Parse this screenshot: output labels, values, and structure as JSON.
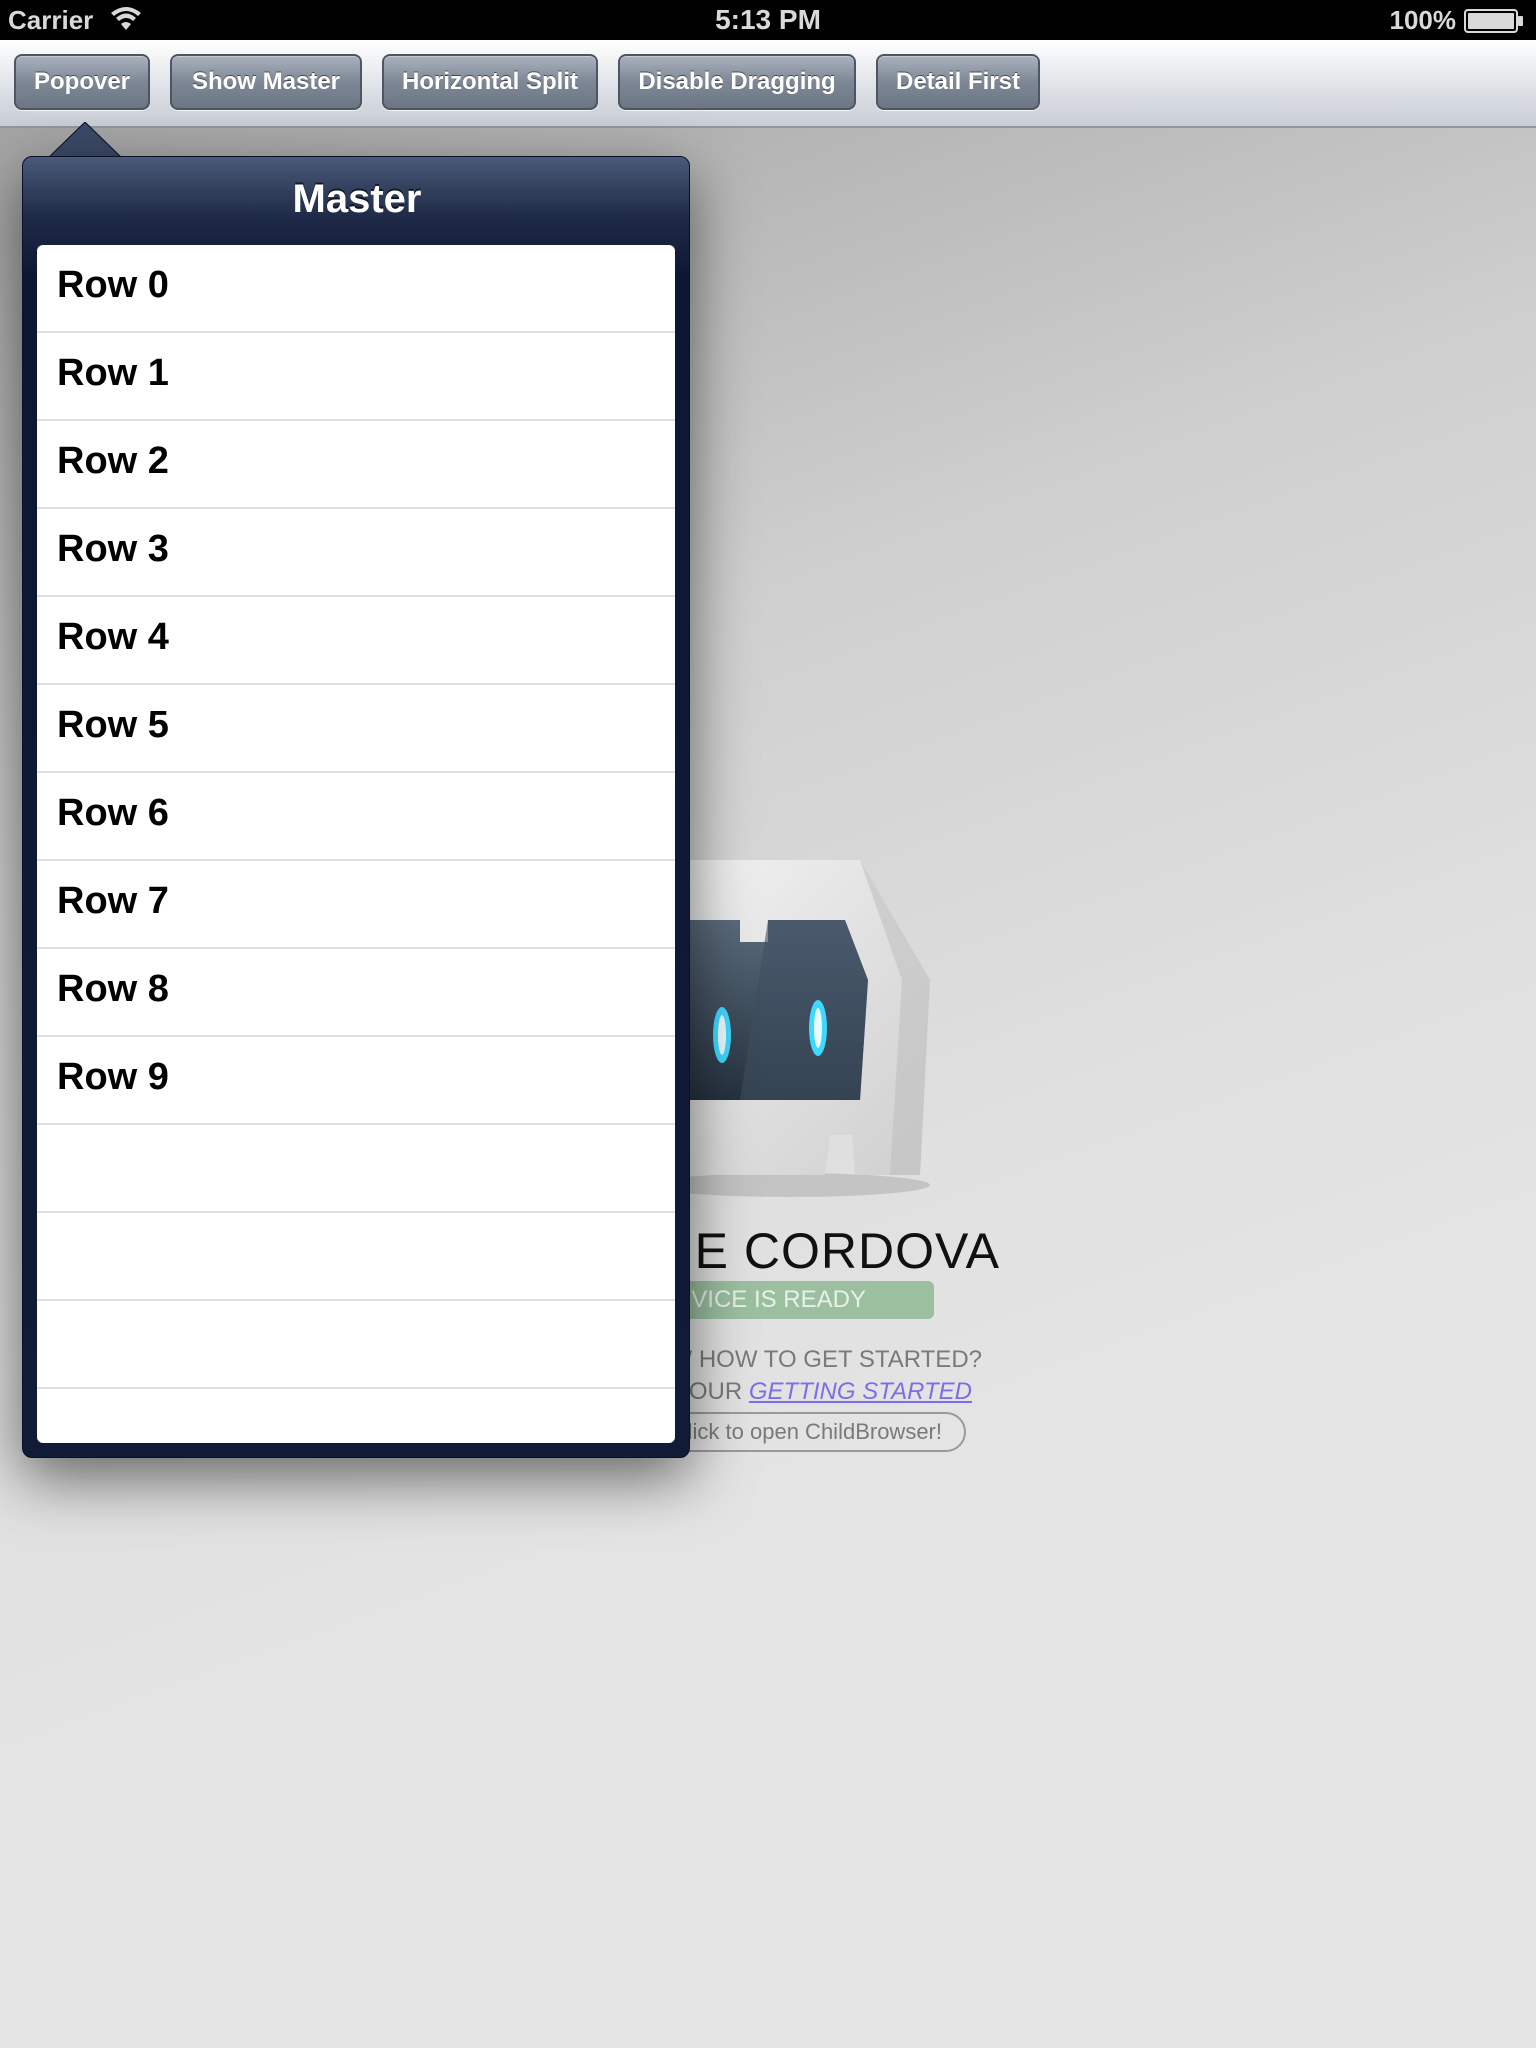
{
  "status_bar": {
    "carrier": "Carrier",
    "time": "5:13 PM",
    "battery_percent": "100%",
    "icons": [
      "wifi-icon",
      "battery-icon"
    ]
  },
  "toolbar": {
    "buttons": [
      {
        "label": "Popover"
      },
      {
        "label": "Show Master"
      },
      {
        "label": "Horizontal Split"
      },
      {
        "label": "Disable Dragging"
      },
      {
        "label": "Detail First"
      }
    ]
  },
  "popover": {
    "title": "Master",
    "rows": [
      "Row 0",
      "Row 1",
      "Row 2",
      "Row 3",
      "Row 4",
      "Row 5",
      "Row 6",
      "Row 7",
      "Row 8",
      "Row 9"
    ]
  },
  "background": {
    "logo_icon": "cordova-logo-icon",
    "app_title": "HE CORDOVA",
    "ready_badge": "EVICE IS READY",
    "help_line1": "W HOW TO GET STARTED?",
    "help_line2_prefix": "T OUR ",
    "help_line2_link": "GETTING STARTED",
    "childbrowser_button": "lick to open ChildBrowser!"
  },
  "colors": {
    "popover_bg": "#111b36",
    "toolbar_button": "#7d8795",
    "ready_badge": "#9bbf9f",
    "link": "#7c6ee6"
  }
}
